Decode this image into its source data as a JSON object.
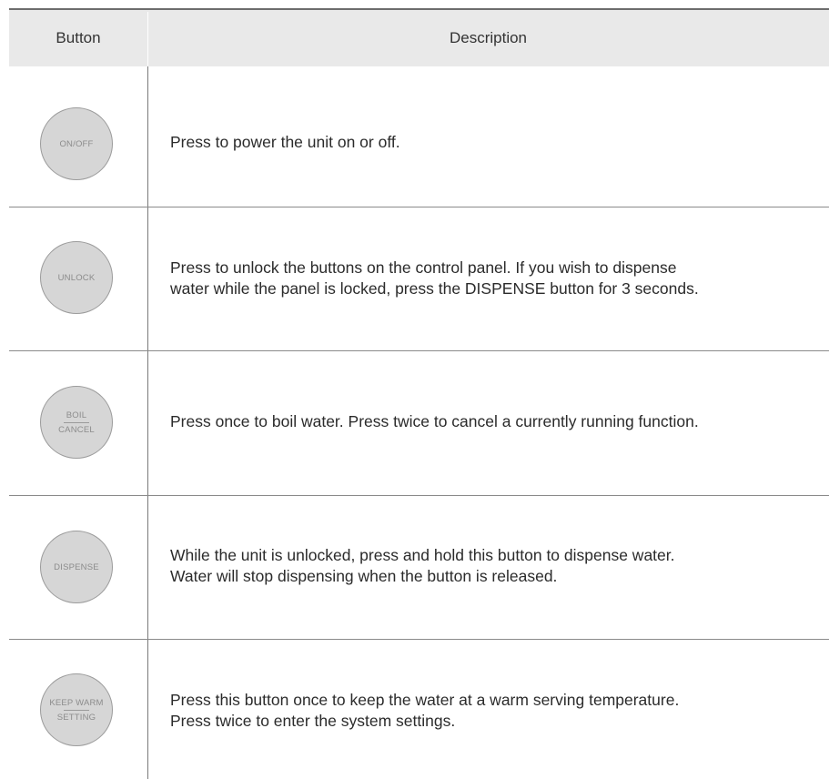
{
  "table": {
    "headers": {
      "button": "Button",
      "description": "Description"
    },
    "rows": [
      {
        "button_label": "ON/OFF",
        "description": [
          "Press to power the unit on or off."
        ]
      },
      {
        "button_label": "UNLOCK",
        "description": [
          "Press to unlock the buttons on the control panel. If you wish to dispense",
          "water while the panel is locked, press the DISPENSE button for 3 seconds."
        ]
      },
      {
        "button_label_top": "BOIL",
        "button_label_bottom": "CANCEL",
        "description": [
          "Press once to boil water. Press twice to cancel a currently running function."
        ]
      },
      {
        "button_label": "DISPENSE",
        "description": [
          "While the unit is unlocked, press and hold this button to dispense water.",
          "Water will stop dispensing when the button is released."
        ]
      },
      {
        "button_label_top": "KEEP WARM",
        "button_label_bottom": "SETTING",
        "description": [
          "Press this button once to keep the water at a warm serving temperature.",
          "Press twice to enter the system settings."
        ]
      }
    ]
  }
}
